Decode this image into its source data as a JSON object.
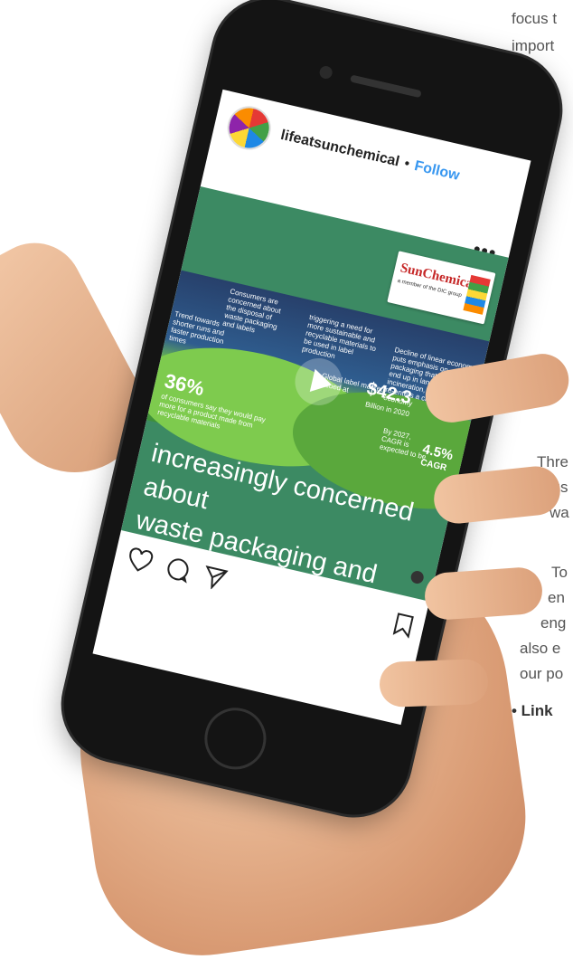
{
  "post": {
    "username": "lifeatsunchemical",
    "separator": "•",
    "follow_label": "Follow",
    "more_label": "•••"
  },
  "media": {
    "logo_text": "SunChemical",
    "logo_sub": "a member of the DIC group",
    "info": {
      "consumers": "Consumers are concerned about the disposal of waste packaging and labels",
      "trend": "Trend towards shorter runs and faster production times",
      "triggering": "triggering a need for more sustainable and recyclable materials to be used in label production",
      "decline": "Decline of linear economy puts emphasis on packaging that doesn't end up in landfill or incineration, but instead re-enters a circular economy",
      "label_market": "Global label market valued at",
      "value_label": "$42.3",
      "by": "Billion in 2020",
      "cagr_text": "By 2027, CAGR is expected to be",
      "cagr_value": "4.5%",
      "cagr_word": "CAGR",
      "pct_value": "36%",
      "pct_text": "of consumers say they would pay more for a product made from recyclable materials"
    },
    "headline_line1": "increasingly concerned about",
    "headline_line2": "waste packaging and labels?"
  },
  "side_text": {
    "line1": "focus t",
    "line2": "import",
    "line3": "Thre",
    "line4": "sus",
    "line5": "wa",
    "line6": "To",
    "line7": "en",
    "line8": "eng",
    "line9": "also e",
    "line10": "our po",
    "line11": "• Link"
  },
  "icons": {
    "like": "heart-icon",
    "comment": "comment-icon",
    "share": "send-icon",
    "save": "bookmark-icon"
  }
}
